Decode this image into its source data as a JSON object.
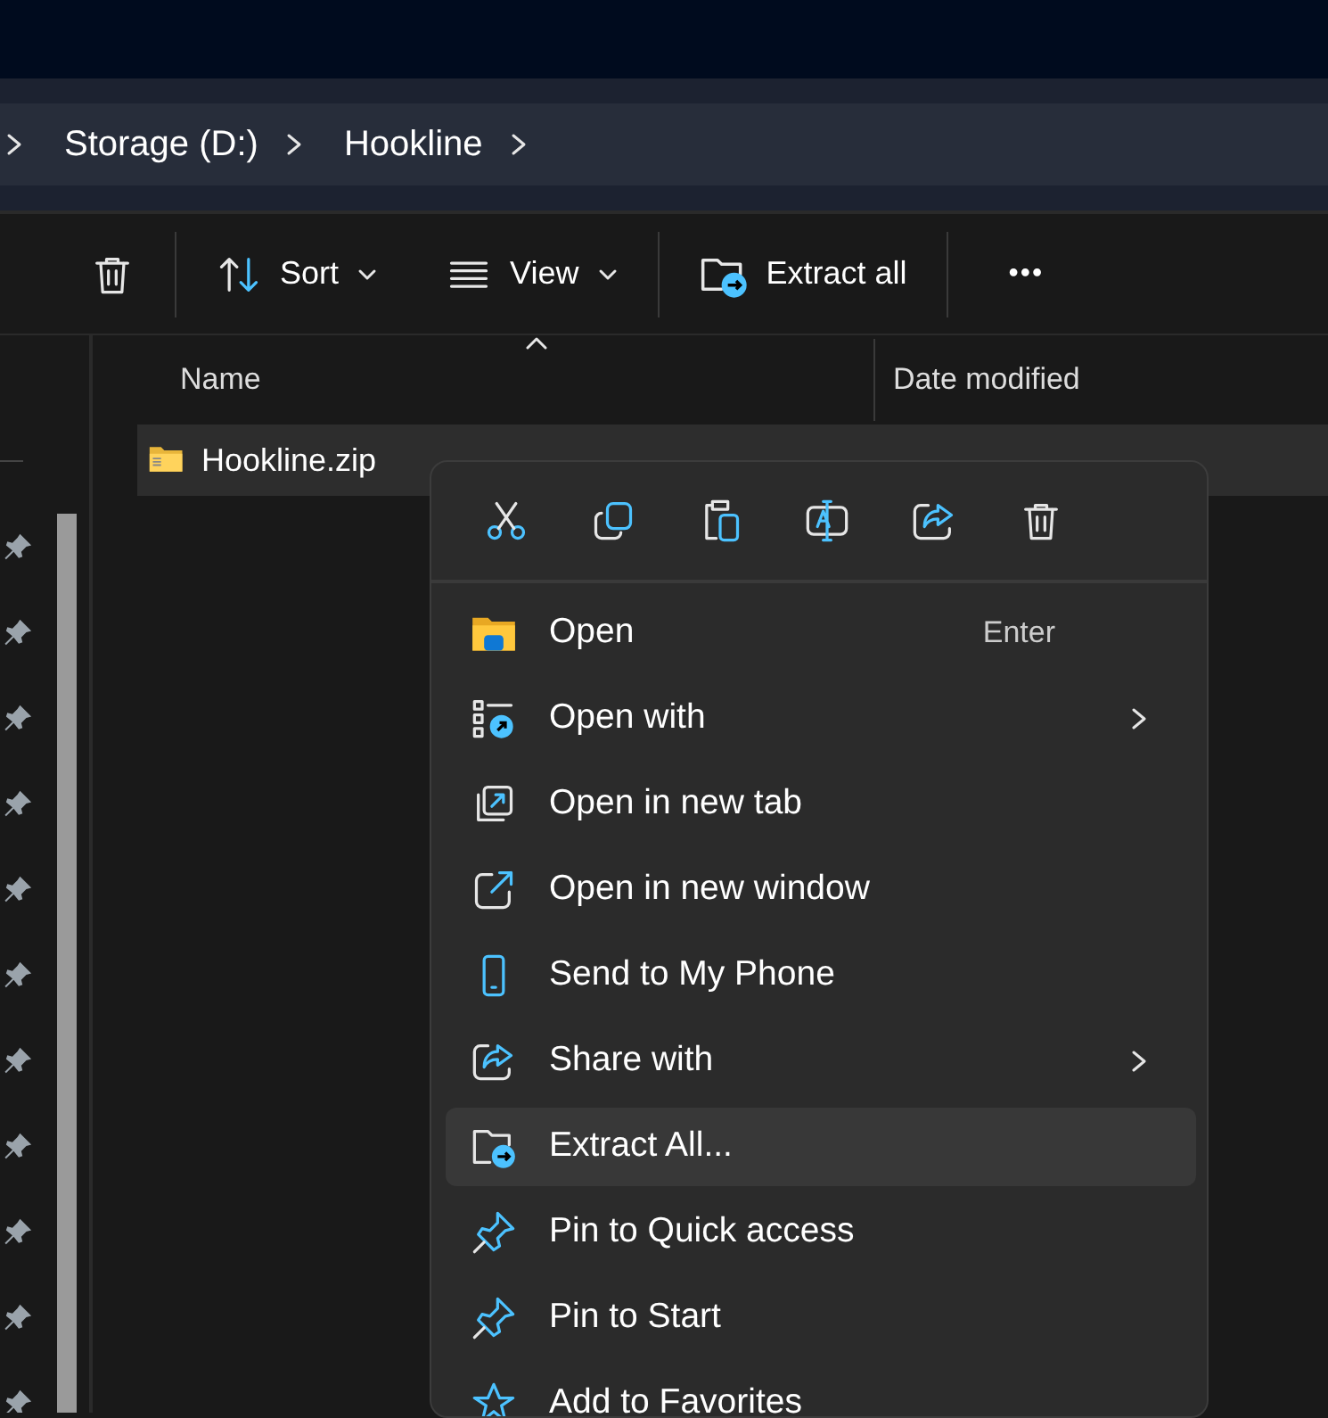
{
  "breadcrumb": [
    "Storage (D:)",
    "Hookline"
  ],
  "toolbar": [
    {
      "kind": "icon"
    },
    {
      "kind": "dropdown",
      "label": "Sort"
    },
    {
      "kind": "dropdown",
      "label": "View"
    },
    {
      "kind": "text",
      "label": "Extract all"
    },
    {
      "kind": "more",
      "label": "•••"
    }
  ],
  "columns": [
    {
      "label": "Name",
      "sorted": true
    },
    {
      "label": "Date modified",
      "sorted": false
    }
  ],
  "files": [
    {
      "name": "Hookline.zip",
      "selected": true
    }
  ],
  "nav_pins": [
    {
      "kind": "pin"
    },
    {
      "kind": "pin"
    },
    {
      "kind": "pin"
    },
    {
      "kind": "pin"
    },
    {
      "kind": "pin"
    },
    {
      "kind": "pin"
    },
    {
      "kind": "pin"
    },
    {
      "kind": "pin"
    },
    {
      "kind": "pin"
    },
    {
      "kind": "pin"
    },
    {
      "kind": "pin"
    }
  ],
  "context_menu": {
    "quick_actions": [
      {
        "kind": "cut"
      },
      {
        "kind": "copy"
      },
      {
        "kind": "paste"
      },
      {
        "kind": "rename"
      },
      {
        "kind": "share"
      },
      {
        "kind": "delete"
      }
    ],
    "items": [
      {
        "label": "Open",
        "shortcut": "Enter",
        "submenu": false,
        "highlighted": false
      },
      {
        "label": "Open with",
        "submenu": true,
        "highlighted": false
      },
      {
        "label": "Open in new tab",
        "submenu": false,
        "highlighted": false
      },
      {
        "label": "Open in new window",
        "submenu": false,
        "highlighted": false
      },
      {
        "label": "Send to My Phone",
        "submenu": false,
        "highlighted": false
      },
      {
        "label": "Share with",
        "submenu": true,
        "highlighted": false
      },
      {
        "label": "Extract All...",
        "submenu": false,
        "highlighted": true
      },
      {
        "label": "Pin to Quick access",
        "submenu": false,
        "highlighted": false
      },
      {
        "label": "Pin to Start",
        "submenu": false,
        "highlighted": false
      },
      {
        "label": "Add to Favorites",
        "submenu": false,
        "highlighted": false
      }
    ]
  }
}
